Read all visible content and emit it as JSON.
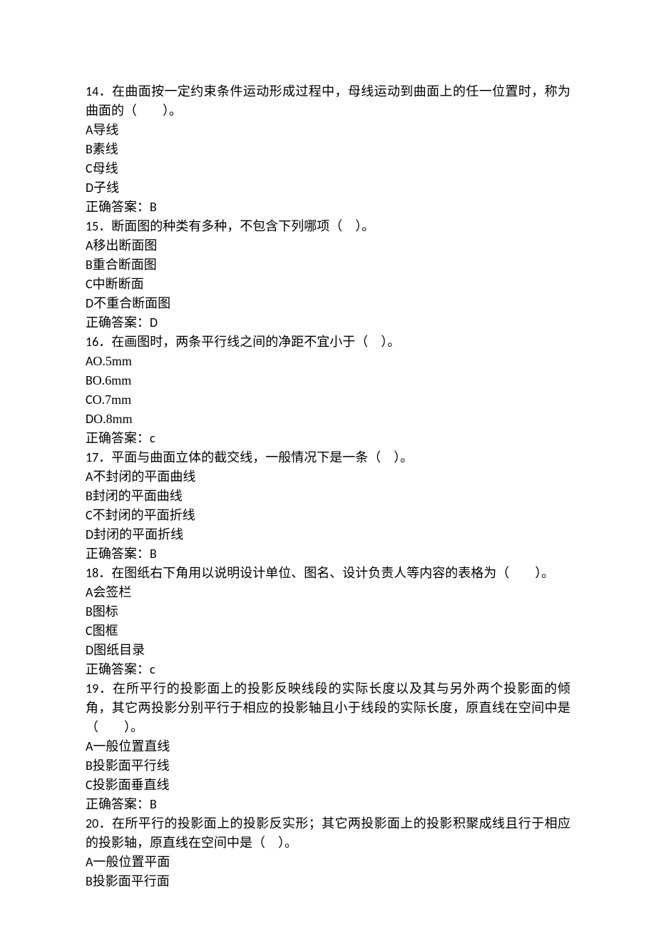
{
  "questions": [
    {
      "num": "14",
      "stem": "．在曲面按一定约束条件运动形成过程中，母线运动到曲面上的任一位置时，称为曲面的（　　）。",
      "options": [
        {
          "letter": "A",
          "text": "导线"
        },
        {
          "letter": "B",
          "text": "素线"
        },
        {
          "letter": "C",
          "text": "母线"
        },
        {
          "letter": "D",
          "text": "子线"
        }
      ],
      "answer_label": "正确答案：",
      "answer": "B"
    },
    {
      "num": "15",
      "stem": "．断面图的种类有多种，不包含下列哪项（　）。",
      "options": [
        {
          "letter": "A",
          "text": "移出断面图"
        },
        {
          "letter": "B",
          "text": "重合断面图"
        },
        {
          "letter": "C",
          "text": "中断断面"
        },
        {
          "letter": "D",
          "text": "不重合断面图"
        }
      ],
      "answer_label": "正确答案：",
      "answer": "D"
    },
    {
      "num": "16",
      "stem": "．在画图时，两条平行线之间的净距不宜小于（　）。",
      "options": [
        {
          "letter": "A",
          "text": "O.5mm"
        },
        {
          "letter": "B",
          "text": "O.6mm"
        },
        {
          "letter": "C",
          "text": "O.7mm"
        },
        {
          "letter": "D",
          "text": "O.8mm"
        }
      ],
      "answer_label": "正确答案：",
      "answer": "c"
    },
    {
      "num": "17",
      "stem": "．平面与曲面立体的截交线，一般情况下是一条（　）。",
      "options": [
        {
          "letter": "A",
          "text": "不封闭的平面曲线"
        },
        {
          "letter": "B",
          "text": "封闭的平面曲线"
        },
        {
          "letter": "C",
          "text": "不封闭的平面折线"
        },
        {
          "letter": "D",
          "text": "封闭的平面折线"
        }
      ],
      "answer_label": "正确答案：",
      "answer": "B"
    },
    {
      "num": "18",
      "stem": "．在图纸右下角用以说明设计单位、图名、设计负责人等内容的表格为（　　）。",
      "options": [
        {
          "letter": "A",
          "text": "会签栏"
        },
        {
          "letter": "B",
          "text": "图标"
        },
        {
          "letter": "C",
          "text": "图框"
        },
        {
          "letter": "D",
          "text": "图纸目录"
        }
      ],
      "answer_label": "正确答案：",
      "answer": "c"
    },
    {
      "num": "19",
      "stem": "．在所平行的投影面上的投影反映线段的实际长度以及其与另外两个投影面的倾角，其它两投影分别平行于相应的投影轴且小于线段的实际长度，原直线在空间中是（　　）。",
      "options": [
        {
          "letter": "A",
          "text": "一般位置直线"
        },
        {
          "letter": "B",
          "text": "投影面平行线"
        },
        {
          "letter": "C",
          "text": "投影面垂直线"
        }
      ],
      "answer_label": "正确答案：",
      "answer": "B"
    },
    {
      "num": "20",
      "stem": "．在所平行的投影面上的投影反实形；其它两投影面上的投影积聚成线且行于相应的投影轴，原直线在空间中是（　）。",
      "options": [
        {
          "letter": "A",
          "text": "一般位置平面"
        },
        {
          "letter": "B",
          "text": "投影面平行面"
        }
      ],
      "answer_label": "",
      "answer": ""
    }
  ]
}
